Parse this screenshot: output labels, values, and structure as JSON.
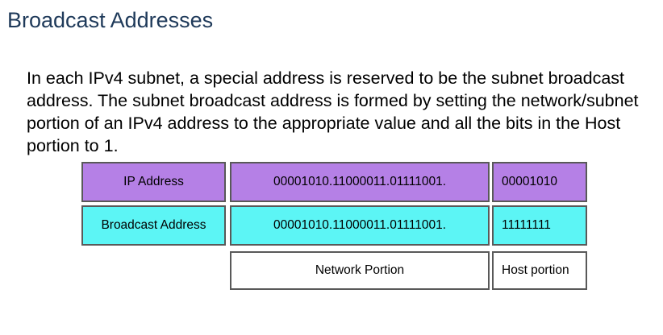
{
  "slide": {
    "title": "Broadcast Addresses",
    "paragraph": "In each IPv4 subnet, a special address is reserved to be the subnet broadcast address. The subnet broadcast address is formed by setting the network/subnet portion of an IPv4 address to the appropriate value and all the bits in the Host portion to 1."
  },
  "table": {
    "ip_row": {
      "label": "IP Address",
      "network": "00001010.11000011.01111001.",
      "host": "00001010"
    },
    "broadcast_row": {
      "label": "Broadcast Address",
      "network": "00001010.11000011.01111001.",
      "host": "11111111"
    },
    "portion_row": {
      "network_label": "Network Portion",
      "host_label": "Host portion"
    }
  },
  "colors": {
    "ip_row_fill": "#b580e6",
    "broadcast_row_fill": "#5cf5f5",
    "title_color": "#1f3a5a"
  }
}
